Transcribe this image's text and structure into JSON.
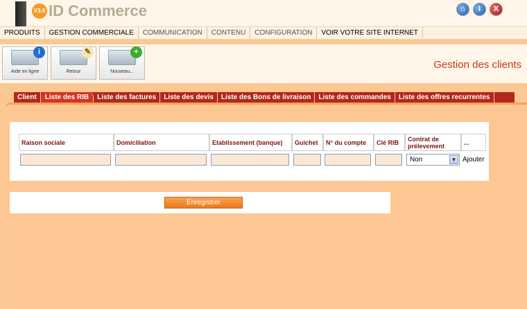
{
  "brand": {
    "logo_text": "ID Commerce",
    "version_badge": "V3.0"
  },
  "header_icons": [
    "home-icon",
    "info-icon",
    "close-icon"
  ],
  "menu": {
    "items": [
      {
        "label": "PRODUITS"
      },
      {
        "label": "GESTION COMMERCIALE"
      },
      {
        "label": "COMMUNICATION"
      },
      {
        "label": "CONTENU"
      },
      {
        "label": "CONFIGURATION"
      },
      {
        "label": "VOIR VOTRE SITE INTERNET"
      }
    ]
  },
  "toolbar": {
    "help_label": "Aide en ligne",
    "back_label": "Retour",
    "new_label": "Nouveau..."
  },
  "page_title": "Gestion des clients",
  "tabs": [
    {
      "label": "Client"
    },
    {
      "label": "Liste des RIB",
      "active": true
    },
    {
      "label": "Liste des factures"
    },
    {
      "label": "Liste des devis"
    },
    {
      "label": "Liste des Bons de livraison"
    },
    {
      "label": "Liste des commandes"
    },
    {
      "label": "Liste des offres recurrentes"
    }
  ],
  "rib_table": {
    "headers": [
      "Raison sociale",
      "Domiciliation",
      "Etablissement (banque)",
      "Guichet",
      "N° du compte",
      "Clé RIB",
      "Contrat de prélevement",
      "..."
    ],
    "new_row": {
      "raison_sociale": "",
      "domiciliation": "",
      "etablissement": "",
      "guichet": "",
      "numero_compte": "",
      "cle_rib": "",
      "contrat_value": "Non",
      "add_label": "Ajouter"
    }
  },
  "save_label": "Enregistrer",
  "colors": {
    "accent_red": "#b1281b",
    "page_title": "#c3391b",
    "background": "#fbc792",
    "button_orange": "#ea7a1c"
  }
}
